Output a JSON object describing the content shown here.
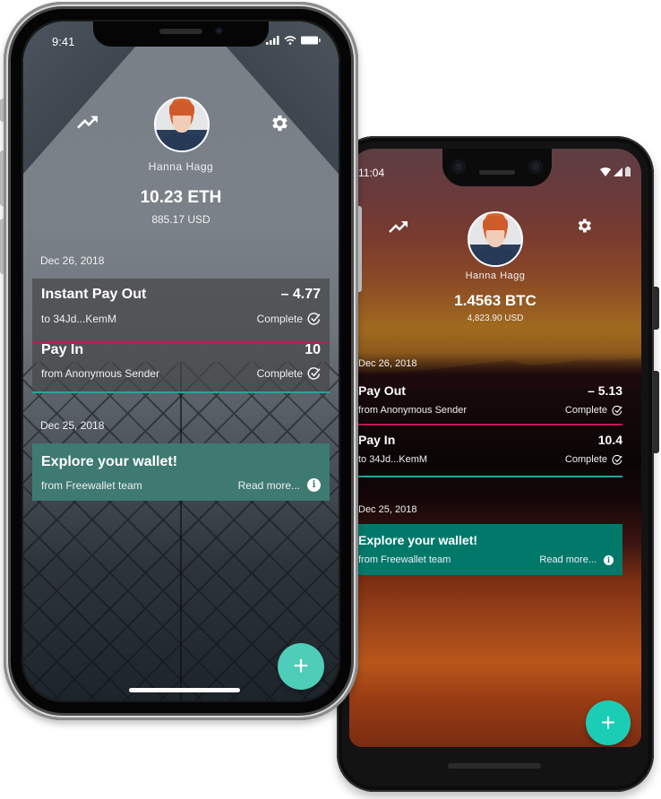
{
  "iphone": {
    "status_bar": {
      "time": "9:41",
      "icons": [
        "cellular-signal-icon",
        "wifi-icon",
        "battery-icon"
      ]
    },
    "header": {
      "left_icon": "trending-up-icon",
      "right_icon": "gear-icon"
    },
    "profile": {
      "name": "Hanna Hagg"
    },
    "balance": {
      "amount": "10.23 ETH",
      "fiat": "885.17 USD"
    },
    "sections": [
      {
        "date": "Dec 26, 2018",
        "transactions": [
          {
            "title": "Instant Pay Out",
            "amount": "– 4.77",
            "counterparty": "to 34Jd...KemM",
            "status": "Complete",
            "accent": "#c2185b"
          },
          {
            "title": "Pay In",
            "amount": "10",
            "counterparty": "from Anonymous Sender",
            "status": "Complete",
            "accent": "#26a69a"
          }
        ]
      },
      {
        "date": "Dec 25, 2018",
        "promo": {
          "title": "Explore your wallet!",
          "from": "from Freewallet team",
          "link": "Read more...",
          "color": "#3e7a71"
        }
      }
    ],
    "fab": {
      "label": "+",
      "color": "#4ecdb8"
    }
  },
  "android": {
    "status_bar": {
      "time": "11:04",
      "icons": [
        "wifi-icon",
        "cellular-signal-icon",
        "battery-icon"
      ]
    },
    "header": {
      "left_icon": "trending-up-icon",
      "right_icon": "gear-icon"
    },
    "profile": {
      "name": "Hanna Hagg"
    },
    "balance": {
      "amount": "1.4563 BTC",
      "fiat": "4,823.90 USD"
    },
    "sections": [
      {
        "date": "Dec 26, 2018",
        "transactions": [
          {
            "title": "Pay Out",
            "amount": "– 5.13",
            "counterparty": "from Anonymous Sender",
            "status": "Complete",
            "accent": "#c2185b"
          },
          {
            "title": "Pay In",
            "amount": "10.4",
            "counterparty": "to 34Jd...KemM",
            "status": "Complete",
            "accent": "#26a69a"
          }
        ]
      },
      {
        "date": "Dec 25, 2018",
        "promo": {
          "title": "Explore your wallet!",
          "from": "from Freewallet team",
          "link": "Read more...",
          "color": "#00796b"
        }
      }
    ],
    "fab": {
      "label": "+",
      "color": "#1ccdb6"
    }
  },
  "icons": {
    "info": "i"
  }
}
